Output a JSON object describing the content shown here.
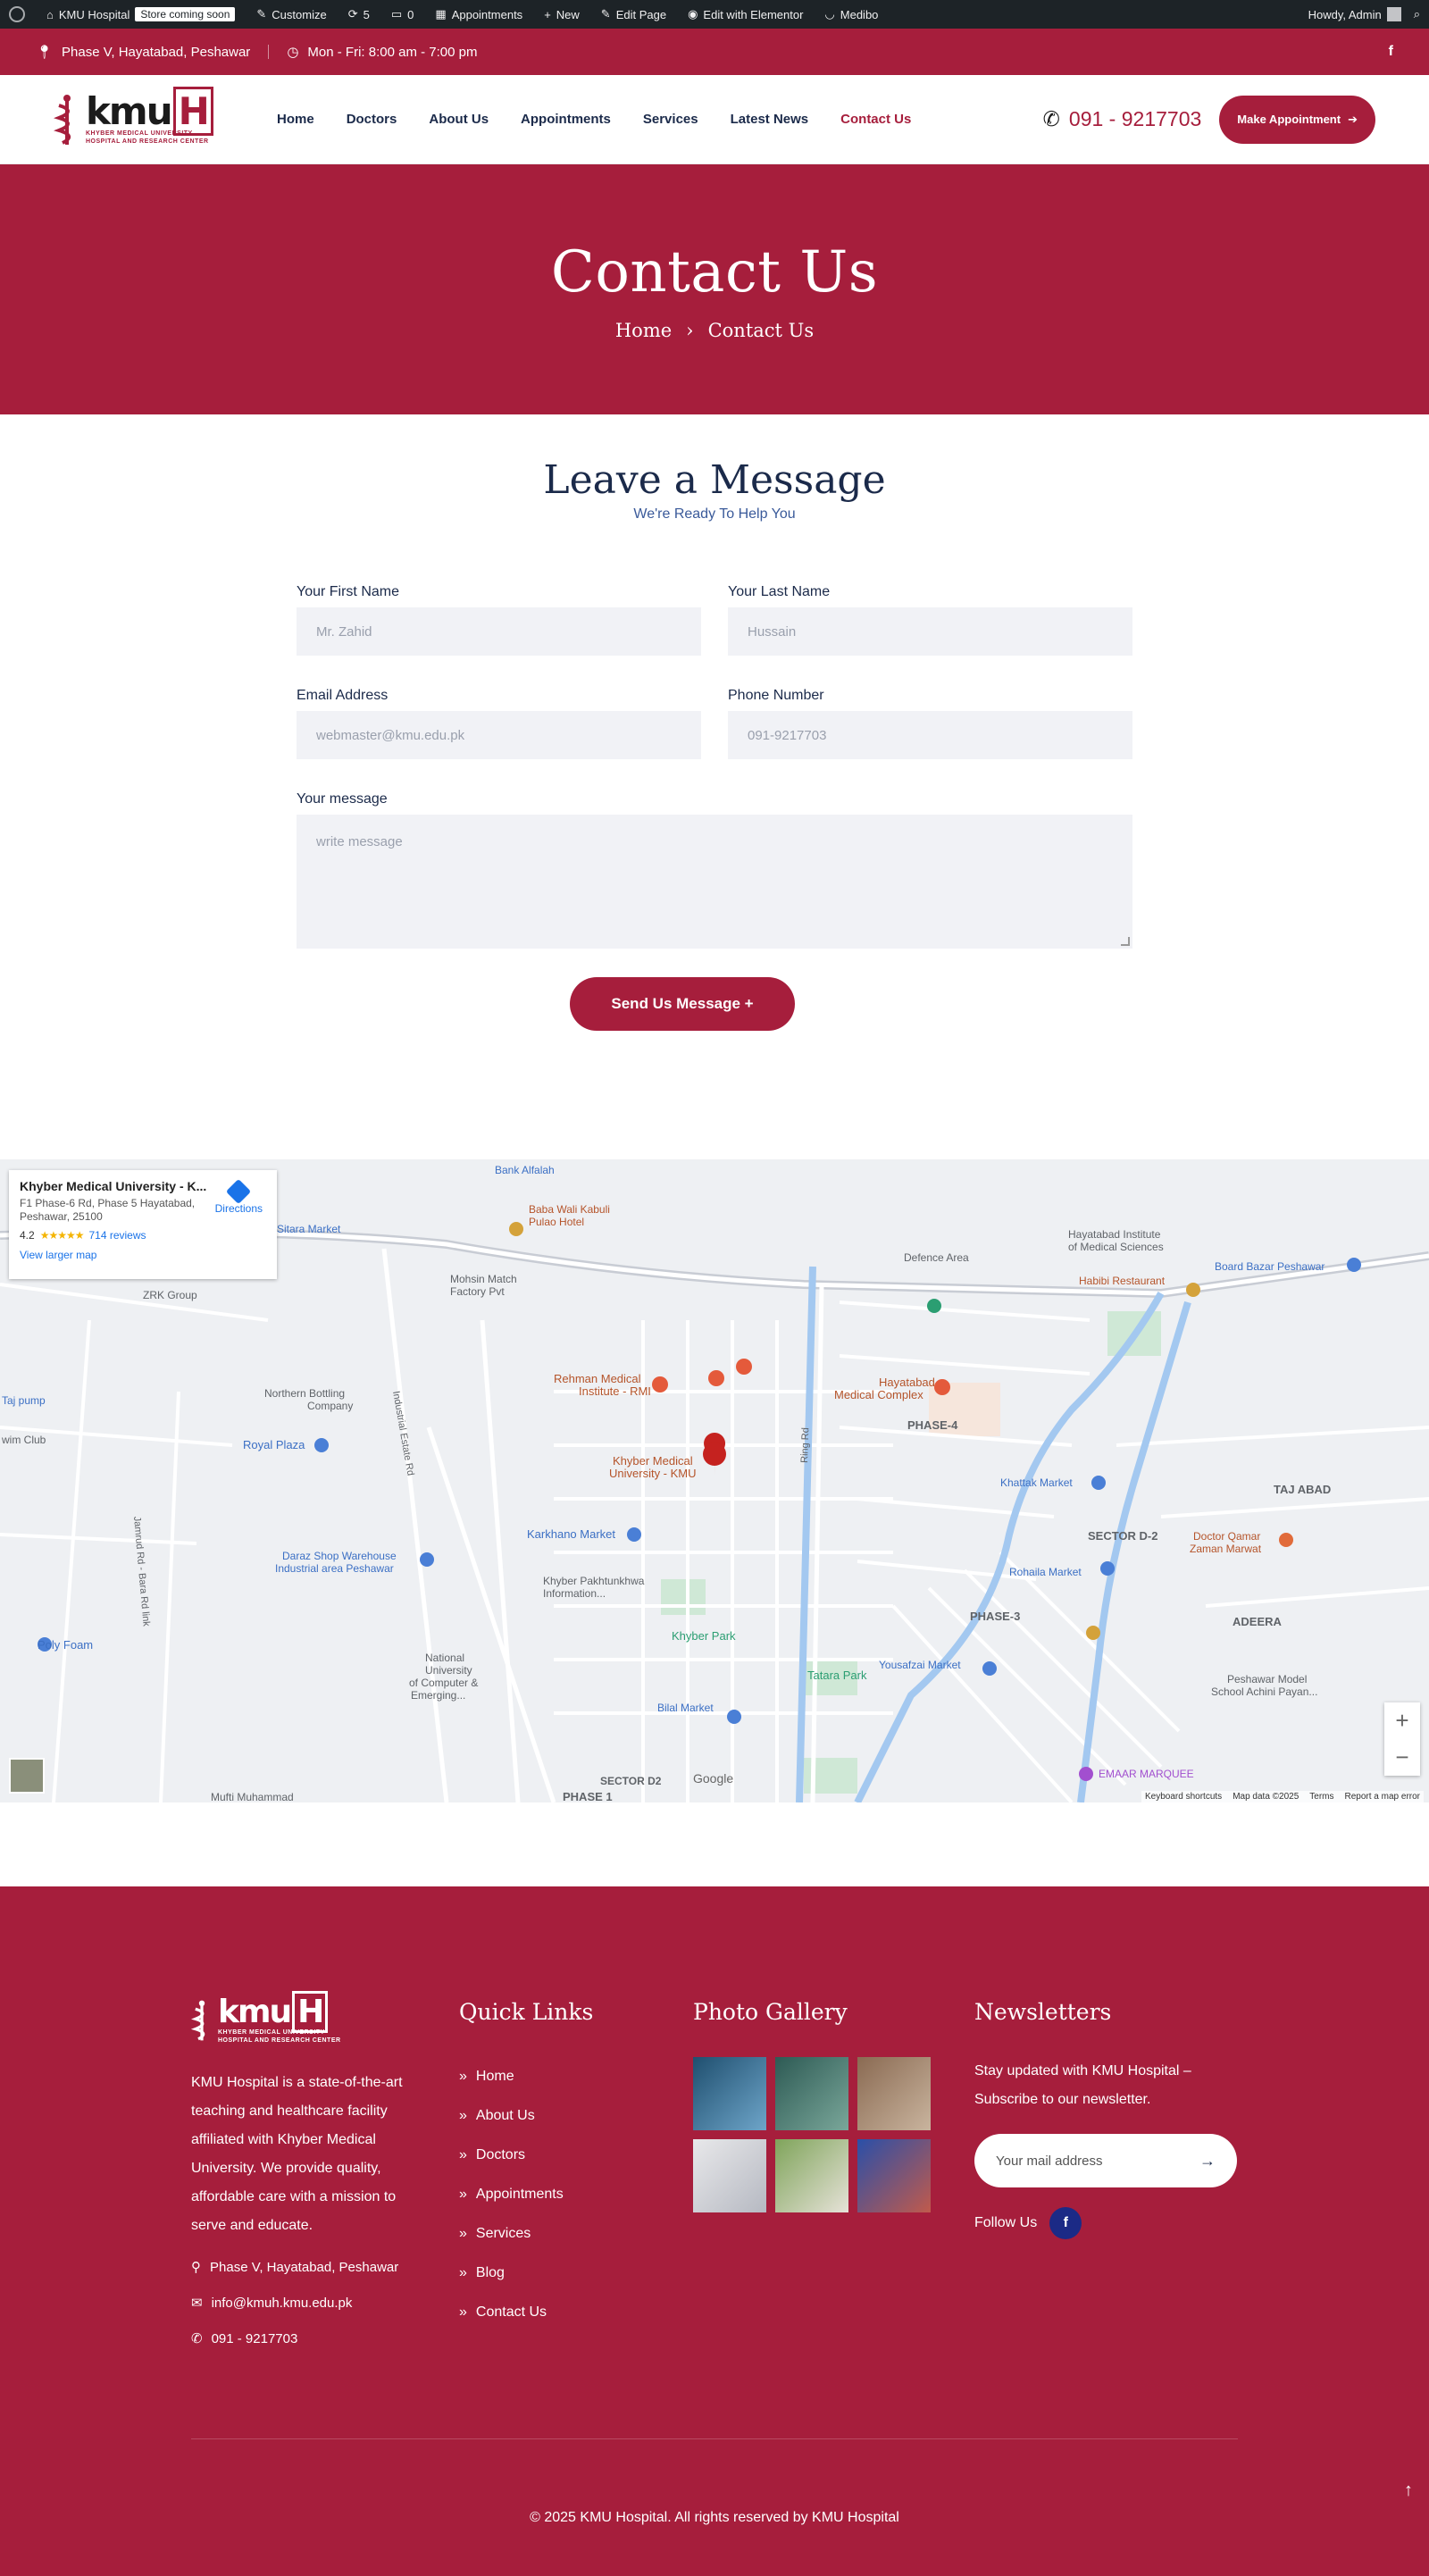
{
  "adminbar": {
    "site": "KMU Hospital",
    "badge": "Store coming soon",
    "customize": "Customize",
    "updates": "5",
    "comments": "0",
    "appointments": "Appointments",
    "new": "New",
    "edit_page": "Edit Page",
    "elementor": "Edit with Elementor",
    "medibo": "Medibo",
    "howdy": "Howdy, Admin"
  },
  "topbar": {
    "address": "Phase V, Hayatabad, Peshawar",
    "hours": "Mon - Fri: 8:00 am - 7:00 pm",
    "social": "f"
  },
  "header": {
    "logo_text": "kmu",
    "logo_h": "H",
    "logo_sub1": "KHYBER MEDICAL UNIVERSITY",
    "logo_sub2": "HOSPITAL AND RESEARCH CENTER",
    "nav": [
      "Home",
      "Doctors",
      "About Us",
      "Appointments",
      "Services",
      "Latest News",
      "Contact Us"
    ],
    "phone": "091 - 9217703",
    "cta": "Make Appointment"
  },
  "hero": {
    "title": "Contact Us",
    "crumb_home": "Home",
    "crumb_current": "Contact Us"
  },
  "contact": {
    "title": "Leave a Message",
    "subtitle": "We're Ready To Help You",
    "first_label": "Your First Name",
    "first_ph": "Mr. Zahid",
    "last_label": "Your Last Name",
    "last_ph": "Hussain",
    "email_label": "Email Address",
    "email_ph": "webmaster@kmu.edu.pk",
    "phone_label": "Phone Number",
    "phone_ph": "091-9217703",
    "msg_label": "Your message",
    "msg_ph": "write message",
    "submit": "Send Us Message +"
  },
  "map": {
    "place": "Khyber Medical University - K...",
    "addr1": "F1 Phase-6 Rd, Phase 5 Hayatabad,",
    "addr2": "Peshawar, 25100",
    "rating": "4.2",
    "stars": "★★★★★",
    "reviews": "714 reviews",
    "larger": "View larger map",
    "directions": "Directions",
    "labels": {
      "kmu": "Khyber Medical",
      "kmu2": "University - KMU",
      "hmc": "Hayatabad",
      "hmc2": "Medical Complex",
      "rmi": "Rehman Medical",
      "rmi2": "Institute - RMI",
      "phase4": "PHASE-4",
      "phase3": "PHASE-3",
      "phase1": "PHASE 1",
      "tajabad": "TAJ ABAD",
      "adeera": "ADEERA",
      "sectord2": "SECTOR D-2",
      "royal": "Royal Plaza",
      "karkhano": "Karkhano Market",
      "tatara": "Tatara Park",
      "khyberpark": "Khyber Park",
      "ringrd": "Ring Rd",
      "defence": "Defence Area",
      "habibi": "Habibi Restaurant",
      "khattak": "Khattak Market",
      "polyfoam": "Poly Foam",
      "zrk": "ZRK Group",
      "northern": "Northern Bottling",
      "company": "Company",
      "bank": "Bank Alfalah",
      "babawali": "Baba Wali Kabuli",
      "pulao": "Pulao Hotel",
      "industrial": "Industrial Estate Rd",
      "jamrud": "Jamrud Rd - Bara Rd link",
      "bilal": "Bilal Market",
      "yousafzai": "Yousafzai Market",
      "emaar": "EMAAR MARQUEE",
      "sitara": "Sitara Market",
      "mohsin": "Mohsin Match",
      "factory": "Factory Pvt",
      "hayatabadinst": "Hayatabad Institute",
      "medsci": "of Medical Sciences",
      "board": "Board Bazar Peshawar",
      "rohaila": "Rohaila Market",
      "daraz": "Daraz Shop Warehouse",
      "ind_area": "Industrial area Peshawar",
      "national": "National",
      "university": "University",
      "ofcomputer": "of Computer &",
      "emerging": "Emerging...",
      "kpinfo": "Khyber Pakhtunkhwa",
      "information": "Information...",
      "qamar": "Doctor Qamar",
      "marwat": "Zaman Marwat",
      "peshawarmodel": "Peshawar Model",
      "achini": "School Achini Payan...",
      "sectord2b": "SECTOR D2",
      "mufti": "Mufti Muhammad",
      "tajpump": "Taj pump",
      "wimclub": "wim Club",
      "google": "Google"
    },
    "footer": [
      "Keyboard shortcuts",
      "Map data ©2025",
      "Terms",
      "Report a map error"
    ]
  },
  "footer": {
    "about": "KMU Hospital is a state-of-the-art teaching and healthcare facility affiliated with Khyber Medical University. We provide quality, affordable care with a mission to serve and educate.",
    "address": "Phase V, Hayatabad, Peshawar",
    "email": "info@kmuh.kmu.edu.pk",
    "phone": "091 - 9217703",
    "quick_title": "Quick Links",
    "quick_links": [
      "Home",
      "About Us",
      "Doctors",
      "Appointments",
      "Services",
      "Blog",
      "Contact Us"
    ],
    "gallery_title": "Photo Gallery",
    "news_title": "Newsletters",
    "news_text": "Stay updated with KMU Hospital – Subscribe to our newsletter.",
    "news_ph": "Your mail address",
    "follow": "Follow Us",
    "copyright": "© 2025 KMU Hospital. All rights reserved by KMU Hospital"
  },
  "colors": {
    "brand": "#a61e3c",
    "navy": "#1b2a4a",
    "admin": "#1d2327"
  }
}
